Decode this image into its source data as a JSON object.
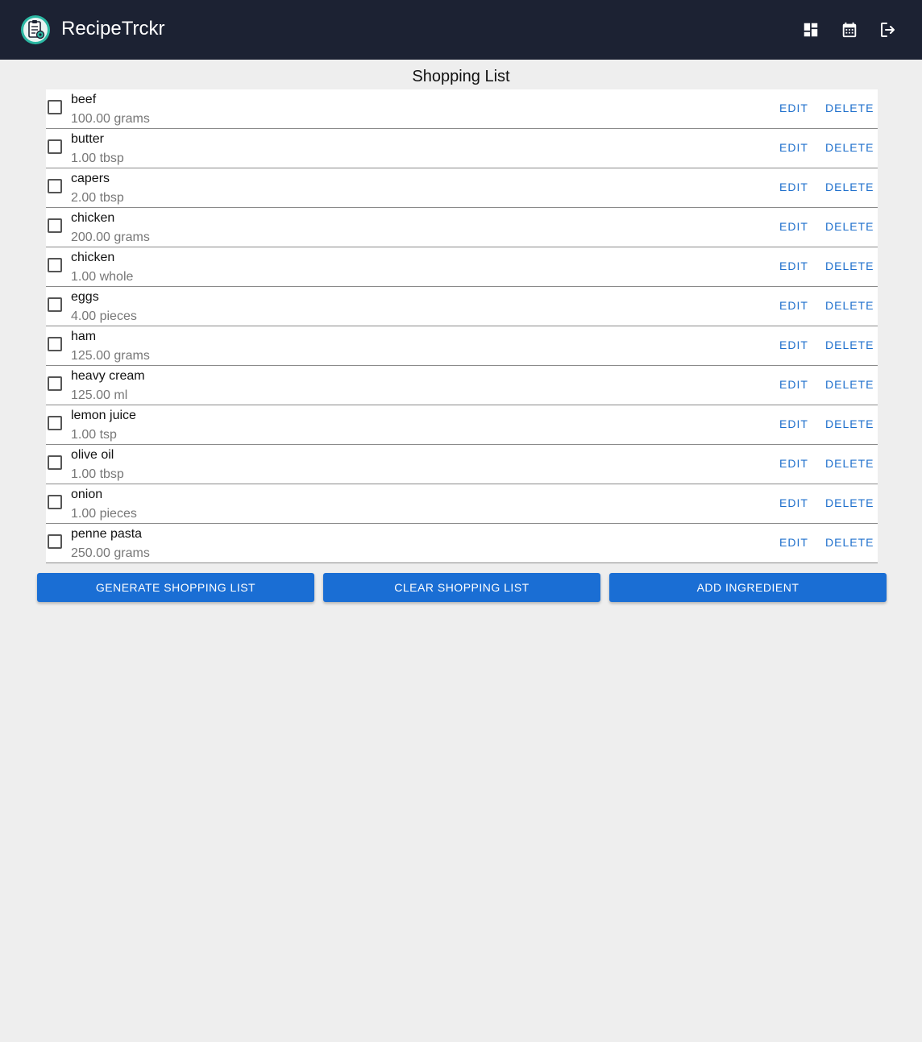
{
  "app": {
    "title": "RecipeTrckr",
    "icons": [
      "recipe-logo-icon",
      "dashboard-icon",
      "calendar-icon",
      "logout-icon"
    ],
    "colors": {
      "appbar": "#1c2233",
      "accent": "#1a6ed4",
      "background": "#eeeeee"
    }
  },
  "page": {
    "title": "Shopping List"
  },
  "items": [
    {
      "name": "beef",
      "qty": "100.00 grams",
      "edit": "EDIT",
      "delete": "DELETE"
    },
    {
      "name": "butter",
      "qty": "1.00 tbsp",
      "edit": "EDIT",
      "delete": "DELETE"
    },
    {
      "name": "capers",
      "qty": "2.00 tbsp",
      "edit": "EDIT",
      "delete": "DELETE"
    },
    {
      "name": "chicken",
      "qty": "200.00 grams",
      "edit": "EDIT",
      "delete": "DELETE"
    },
    {
      "name": "chicken",
      "qty": "1.00 whole",
      "edit": "EDIT",
      "delete": "DELETE"
    },
    {
      "name": "eggs",
      "qty": "4.00 pieces",
      "edit": "EDIT",
      "delete": "DELETE"
    },
    {
      "name": "ham",
      "qty": "125.00 grams",
      "edit": "EDIT",
      "delete": "DELETE"
    },
    {
      "name": "heavy cream",
      "qty": "125.00 ml",
      "edit": "EDIT",
      "delete": "DELETE"
    },
    {
      "name": "lemon juice",
      "qty": "1.00 tsp",
      "edit": "EDIT",
      "delete": "DELETE"
    },
    {
      "name": "olive oil",
      "qty": "1.00 tbsp",
      "edit": "EDIT",
      "delete": "DELETE"
    },
    {
      "name": "onion",
      "qty": "1.00 pieces",
      "edit": "EDIT",
      "delete": "DELETE"
    },
    {
      "name": "penne pasta",
      "qty": "250.00 grams",
      "edit": "EDIT",
      "delete": "DELETE"
    }
  ],
  "actions": {
    "generate": "GENERATE SHOPPING LIST",
    "clear": "CLEAR SHOPPING LIST",
    "add": "ADD INGREDIENT"
  }
}
